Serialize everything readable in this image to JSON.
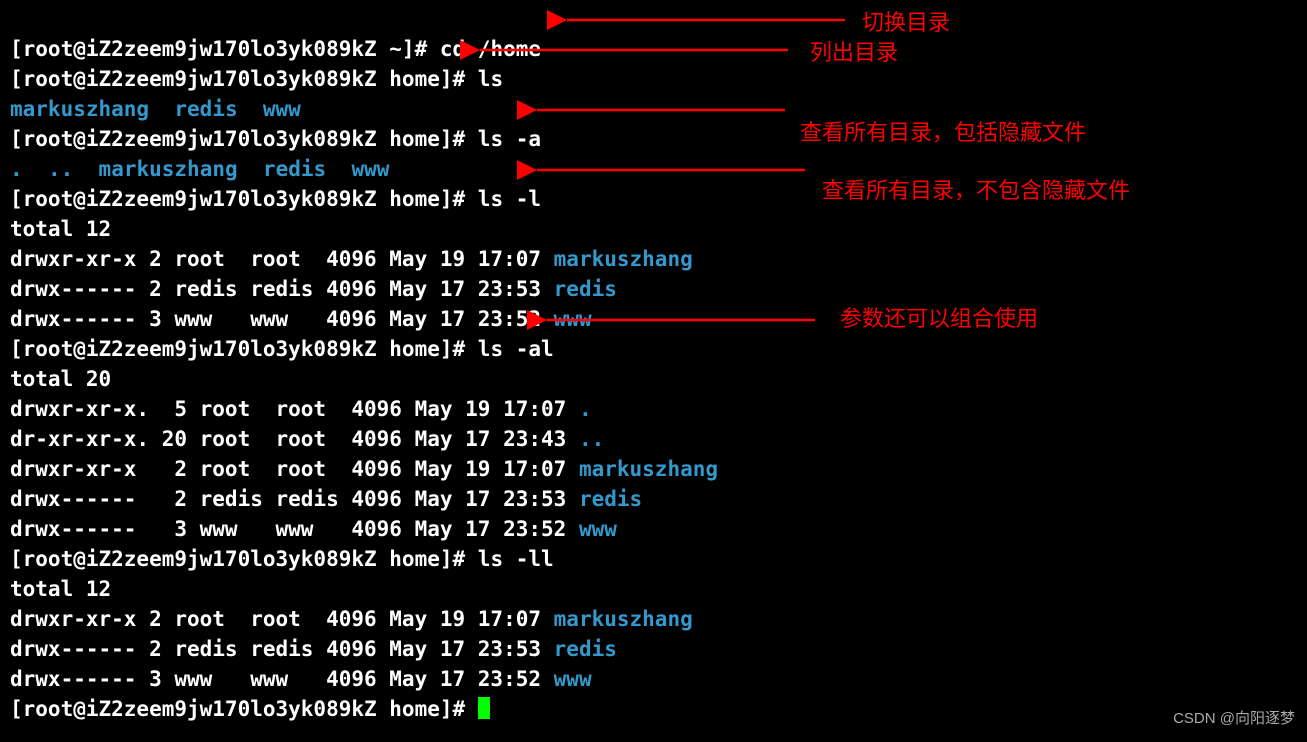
{
  "host": "iZ2zeem9jw170lo3yk089kZ",
  "user": "root",
  "prompts": {
    "p1": "[root@iZ2zeem9jw170lo3yk089kZ ~]# ",
    "p2": "[root@iZ2zeem9jw170lo3yk089kZ home]# "
  },
  "commands": {
    "cd": "cd /home",
    "ls": "ls",
    "lsa": "ls -a",
    "lsl": "ls -l",
    "lsal": "ls -al",
    "lsll": "ls -ll"
  },
  "ls_out": {
    "a": "markuszhang",
    "b": "redis",
    "c": "www"
  },
  "lsa_out": {
    "a": ".",
    "b": "..",
    "c": "markuszhang",
    "d": "redis",
    "e": "www"
  },
  "lsl": {
    "total": "total 12",
    "r1": {
      "meta": "drwxr-xr-x 2 root  root  4096 May 19 17:07 ",
      "name": "markuszhang"
    },
    "r2": {
      "meta": "drwx------ 2 redis redis 4096 May 17 23:53 ",
      "name": "redis"
    },
    "r3": {
      "meta": "drwx------ 3 www   www   4096 May 17 23:52 ",
      "name": "www"
    }
  },
  "lsal": {
    "total": "total 20",
    "r1": {
      "meta": "drwxr-xr-x.  5 root  root  4096 May 19 17:07 ",
      "name": "."
    },
    "r2": {
      "meta": "dr-xr-xr-x. 20 root  root  4096 May 17 23:43 ",
      "name": ".."
    },
    "r3": {
      "meta": "drwxr-xr-x   2 root  root  4096 May 19 17:07 ",
      "name": "markuszhang"
    },
    "r4": {
      "meta": "drwx------   2 redis redis 4096 May 17 23:53 ",
      "name": "redis"
    },
    "r5": {
      "meta": "drwx------   3 www   www   4096 May 17 23:52 ",
      "name": "www"
    }
  },
  "annotations": {
    "a1": "切换目录",
    "a2": "列出目录",
    "a3": "查看所有目录，包括隐藏文件",
    "a4": "查看所有目录，不包含隐藏文件",
    "a5": "参数还可以组合使用"
  },
  "watermark": "CSDN @向阳逐梦"
}
